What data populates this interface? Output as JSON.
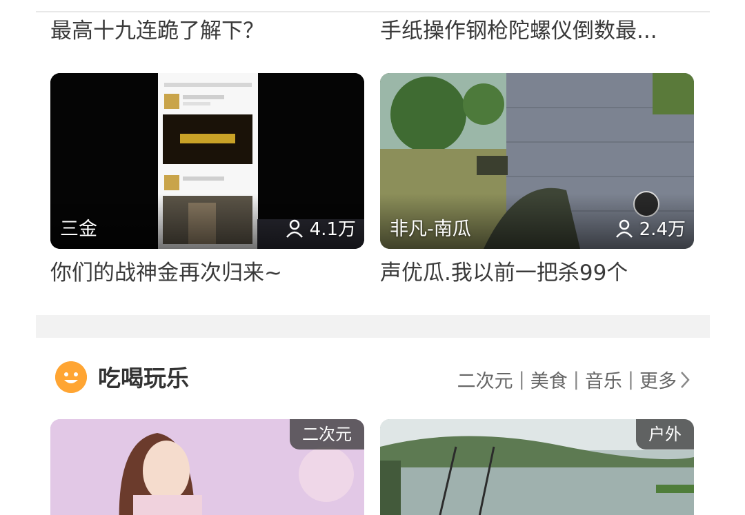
{
  "top_captions": [
    "最高十九连跪了解下？",
    "手纸操作钢枪陀螺仪倒数最..."
  ],
  "cards": [
    {
      "name": "三金",
      "viewers": "4.1万",
      "caption": "你们的战神金再次归来~"
    },
    {
      "name": "非凡-南瓜",
      "viewers": "2.4万",
      "caption": "声优瓜.我以前一把杀99个"
    }
  ],
  "section": {
    "title": "吃喝玩乐",
    "links": [
      "二次元",
      "美食",
      "音乐",
      "更多"
    ]
  },
  "bottom_cards": [
    {
      "tag": "二次元"
    },
    {
      "tag": "户外"
    }
  ]
}
